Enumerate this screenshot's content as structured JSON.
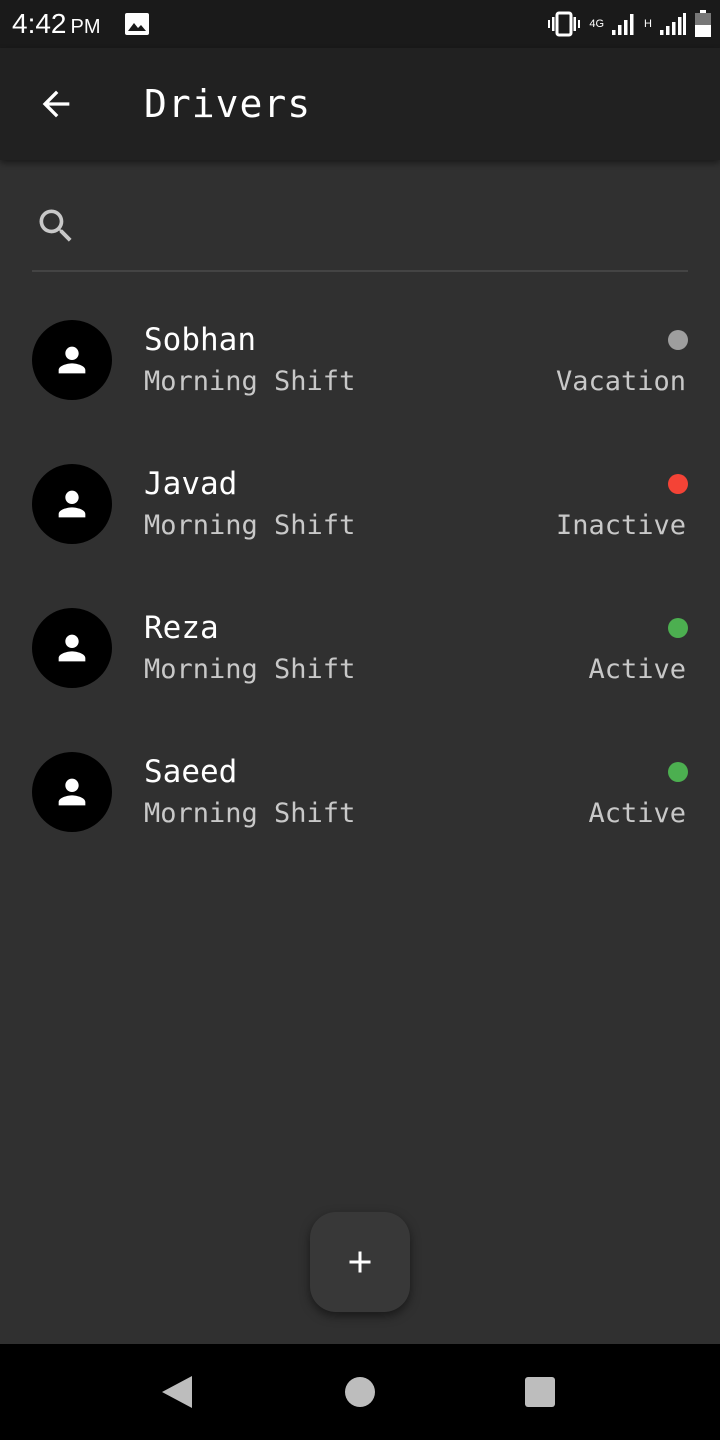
{
  "status_bar": {
    "time": "4:42",
    "ampm": "PM",
    "network_4g": "4G",
    "network_h": "H",
    "icons": [
      "gallery-icon",
      "vibrate-icon",
      "signal-icon",
      "battery-icon"
    ]
  },
  "app_bar": {
    "title": "Drivers",
    "back_icon": "arrow-back-icon"
  },
  "search": {
    "placeholder": "",
    "value": "",
    "icon": "search-icon"
  },
  "drivers": [
    {
      "name": "Sobhan",
      "shift": "Morning Shift",
      "status": "Vacation",
      "status_color": "#9e9e9e"
    },
    {
      "name": "Javad",
      "shift": "Morning Shift",
      "status": "Inactive",
      "status_color": "#f44336"
    },
    {
      "name": "Reza",
      "shift": "Morning Shift",
      "status": "Active",
      "status_color": "#4caf50"
    },
    {
      "name": "Saeed",
      "shift": "Morning Shift",
      "status": "Active",
      "status_color": "#4caf50"
    }
  ],
  "fab": {
    "icon": "plus-icon"
  },
  "nav_bar": {
    "icons": [
      "nav-back-icon",
      "nav-home-icon",
      "nav-recents-icon"
    ]
  },
  "colors": {
    "background": "#303030",
    "app_bar": "#212121",
    "status_bar": "#1a1a1a"
  }
}
